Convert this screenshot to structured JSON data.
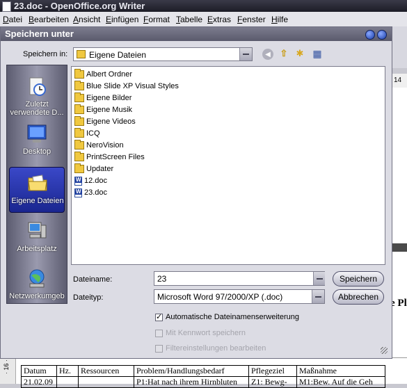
{
  "app": {
    "title": "23.doc - OpenOffice.org Writer",
    "menu": [
      "Datei",
      "Bearbeiten",
      "Ansicht",
      "Einfügen",
      "Format",
      "Tabelle",
      "Extras",
      "Fenster",
      "Hilfe"
    ]
  },
  "ruler_right": {
    "value": "14"
  },
  "doc_fragment": {
    "heading_text": "e Pl"
  },
  "vertical_ruler": {
    "value": "· 16 ·"
  },
  "table": {
    "headers": [
      "Datum",
      "Hz.",
      "Ressourcen",
      "Problem/Handlungsbedarf",
      "Pflegeziel",
      "Maßnahme"
    ],
    "row1": [
      "21.02.09",
      "",
      "",
      "P1:Hat nach ihrem Hirnbluten",
      "Z1: Bewg-",
      "M1:Bew. Auf die Geh"
    ]
  },
  "dialog": {
    "title": "Speichern unter",
    "save_in_label": "Speichern in:",
    "save_in_value": "Eigene Dateien",
    "places": [
      {
        "label": "Zuletzt verwendete D...",
        "icon": "recent-icon",
        "active": false
      },
      {
        "label": "Desktop",
        "icon": "desktop-icon",
        "active": false
      },
      {
        "label": "Eigene Dateien",
        "icon": "my-documents-icon",
        "active": true
      },
      {
        "label": "Arbeitsplatz",
        "icon": "my-computer-icon",
        "active": false
      },
      {
        "label": "Netzwerkumgeb",
        "icon": "network-icon",
        "active": false
      }
    ],
    "files": [
      {
        "name": "Albert Ordner",
        "type": "folder"
      },
      {
        "name": "Blue Slide XP Visual Styles",
        "type": "folder"
      },
      {
        "name": "Eigene Bilder",
        "type": "folder"
      },
      {
        "name": "Eigene Musik",
        "type": "folder"
      },
      {
        "name": "Eigene Videos",
        "type": "folder"
      },
      {
        "name": "ICQ",
        "type": "folder"
      },
      {
        "name": "NeroVision",
        "type": "folder"
      },
      {
        "name": "PrintScreen Files",
        "type": "folder"
      },
      {
        "name": "Updater",
        "type": "folder"
      },
      {
        "name": "12.doc",
        "type": "doc"
      },
      {
        "name": "23.doc",
        "type": "doc"
      }
    ],
    "filename_label": "Dateiname:",
    "filename_value": "23",
    "filetype_label": "Dateityp:",
    "filetype_value": "Microsoft Word 97/2000/XP (.doc)",
    "save_button": "Speichern",
    "cancel_button": "Abbrechen",
    "options": [
      {
        "label": "Automatische Dateinamenserweiterung",
        "checked": true,
        "enabled": true
      },
      {
        "label": "Mit Kennwort speichern",
        "checked": false,
        "enabled": false
      },
      {
        "label": "Filtereinstellungen bearbeiten",
        "checked": false,
        "enabled": false
      }
    ]
  }
}
